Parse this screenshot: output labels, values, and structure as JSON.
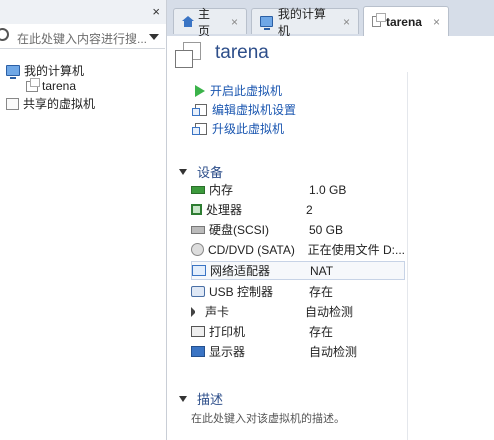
{
  "colors": {
    "accent": "#2d4e8a",
    "link": "#1a56b0",
    "play": "#3bb34a"
  },
  "library": {
    "close": "×",
    "search_placeholder": "在此处键入内容进行搜...",
    "tree": [
      {
        "label": "我的计算机",
        "icon": "computer-icon"
      },
      {
        "label": "tarena",
        "icon": "vm-icon"
      },
      {
        "label": "共享的虚拟机",
        "icon": "shared-vm-icon"
      }
    ]
  },
  "tabs": [
    {
      "label": "主页",
      "icon": "home-icon",
      "close": "×"
    },
    {
      "label": "我的计算机",
      "icon": "computer-icon",
      "close": "×"
    },
    {
      "label": "tarena",
      "icon": "vm-icon",
      "close": "×"
    }
  ],
  "vm": {
    "name": "tarena",
    "actions": [
      "开启此虚拟机",
      "编辑虚拟机设置",
      "升级此虚拟机"
    ],
    "devices_header": "设备",
    "devices": [
      {
        "name": "内存",
        "value": "1.0 GB",
        "icon": "memory-icon"
      },
      {
        "name": "处理器",
        "value": "2",
        "icon": "cpu-icon"
      },
      {
        "name": "硬盘(SCSI)",
        "value": "50 GB",
        "icon": "hdd-icon"
      },
      {
        "name": "CD/DVD (SATA)",
        "value": "正在使用文件 D:...",
        "icon": "cd-icon"
      },
      {
        "name": "网络适配器",
        "value": "NAT",
        "icon": "network-icon"
      },
      {
        "name": "USB 控制器",
        "value": "存在",
        "icon": "usb-icon"
      },
      {
        "name": "声卡",
        "value": "自动检测",
        "icon": "sound-icon"
      },
      {
        "name": "打印机",
        "value": "存在",
        "icon": "printer-icon"
      },
      {
        "name": "显示器",
        "value": "自动检测",
        "icon": "display-icon"
      }
    ],
    "description_header": "描述",
    "description_placeholder": "在此处键入对该虚拟机的描述。"
  }
}
